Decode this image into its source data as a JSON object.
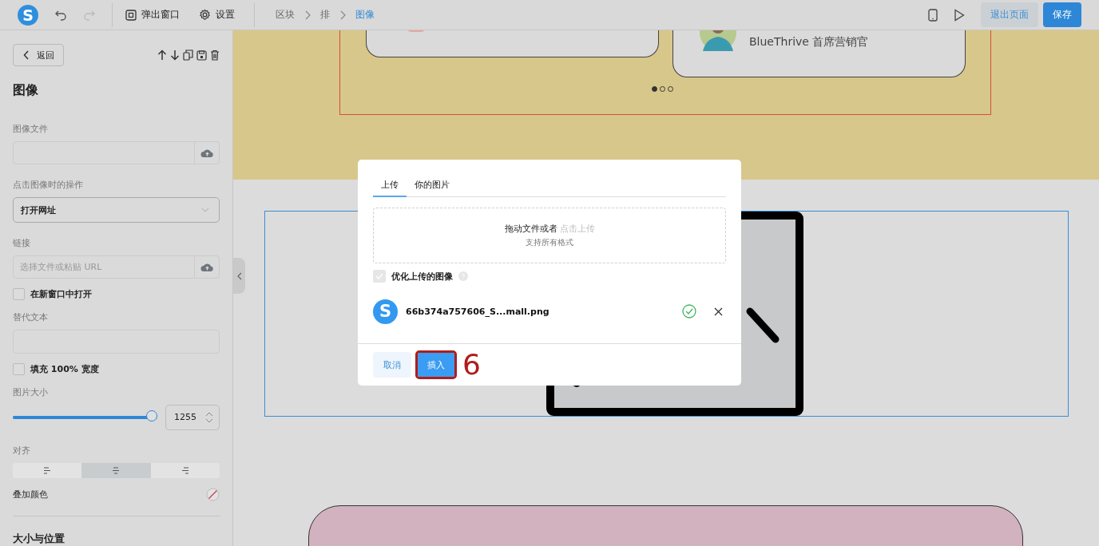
{
  "topbar": {
    "logo": "S",
    "popup_button": "弹出窗口",
    "settings_button": "设置",
    "breadcrumb": [
      {
        "label": "区块",
        "selected": false
      },
      {
        "label": "排",
        "selected": false
      },
      {
        "label": "图像",
        "selected": true
      }
    ],
    "exit_button": "退出页面",
    "save_button": "保存"
  },
  "sidebar": {
    "back_button": "返回",
    "title": "图像",
    "image_file": {
      "label": "图像文件"
    },
    "click_action": {
      "label": "点击图像时的操作",
      "value": "打开网址"
    },
    "link": {
      "label": "链接",
      "placeholder": "选择文件或粘贴 URL"
    },
    "open_new_window": {
      "label": "在新窗口中打开",
      "checked": false
    },
    "alt_text": {
      "label": "替代文本"
    },
    "fill_width": {
      "label": "填充 100% 宽度",
      "checked": false
    },
    "image_size": {
      "label": "图片大小",
      "level": 0.97,
      "value": "1255"
    },
    "align": {
      "label": "对齐",
      "options": [
        {
          "kind": "left",
          "selected": false
        },
        {
          "kind": "center",
          "selected": true
        },
        {
          "kind": "right",
          "selected": false
        }
      ]
    },
    "overlay_color": {
      "label": "叠加颜色"
    },
    "section_title": "大小与位置"
  },
  "canvas": {
    "testimonial": "BlueThrive 首席营销官",
    "dots": [
      {
        "selected": true
      },
      {
        "selected": false
      },
      {
        "selected": false
      }
    ]
  },
  "dialog": {
    "tabs": [
      {
        "label": "上传",
        "selected": true
      },
      {
        "label": "你的图片",
        "selected": false
      }
    ],
    "dropzone": {
      "text": "拖动文件或者",
      "link": "点击上传",
      "hint": "支持所有格式"
    },
    "optimize": {
      "label": "优化上传的图像",
      "checked": true
    },
    "file": {
      "avatar": "S",
      "name": "66b374a757606_S...mall.png"
    },
    "cancel_button": "取消",
    "insert_button": "插入",
    "step_number": "6"
  }
}
